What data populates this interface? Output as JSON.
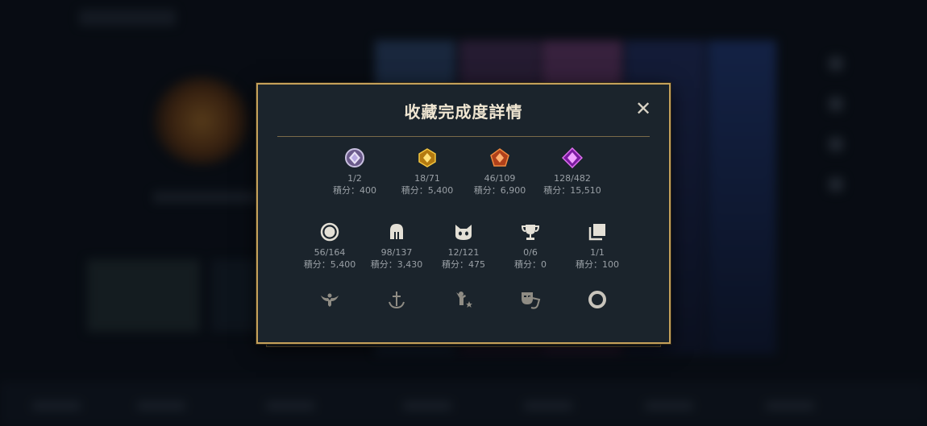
{
  "modal": {
    "title": "收藏完成度詳情",
    "close_label": "✕"
  },
  "rarity_stats": [
    {
      "icon": "crystal-white-icon",
      "count": "1/2",
      "points": "積分：400"
    },
    {
      "icon": "crystal-gold-icon",
      "count": "18/71",
      "points": "積分：5,400"
    },
    {
      "icon": "crystal-orange-icon",
      "count": "46/109",
      "points": "積分：6,900"
    },
    {
      "icon": "crystal-purple-icon",
      "count": "128/482",
      "points": "積分：15,510"
    }
  ],
  "category_stats": [
    {
      "icon": "icon-ring-icon",
      "count": "56/164",
      "points": "積分：5,400"
    },
    {
      "icon": "helmet-icon",
      "count": "98/137",
      "points": "積分：3,430"
    },
    {
      "icon": "cat-face-icon",
      "count": "12/121",
      "points": "積分：475"
    },
    {
      "icon": "trophy-icon",
      "count": "0/6",
      "points": "積分：0"
    },
    {
      "icon": "cards-icon",
      "count": "1/1",
      "points": "積分：100"
    }
  ],
  "locked_categories": [
    {
      "icon": "winged-emblem-icon"
    },
    {
      "icon": "anchor-sword-icon"
    },
    {
      "icon": "figure-star-icon"
    },
    {
      "icon": "masks-icon"
    },
    {
      "icon": "circle-frame-icon"
    }
  ],
  "colors": {
    "border_gold": "#c5a15a",
    "modal_bg": "#1b242c",
    "title": "#f0e6d2",
    "text_muted": "#9aa0a6"
  }
}
